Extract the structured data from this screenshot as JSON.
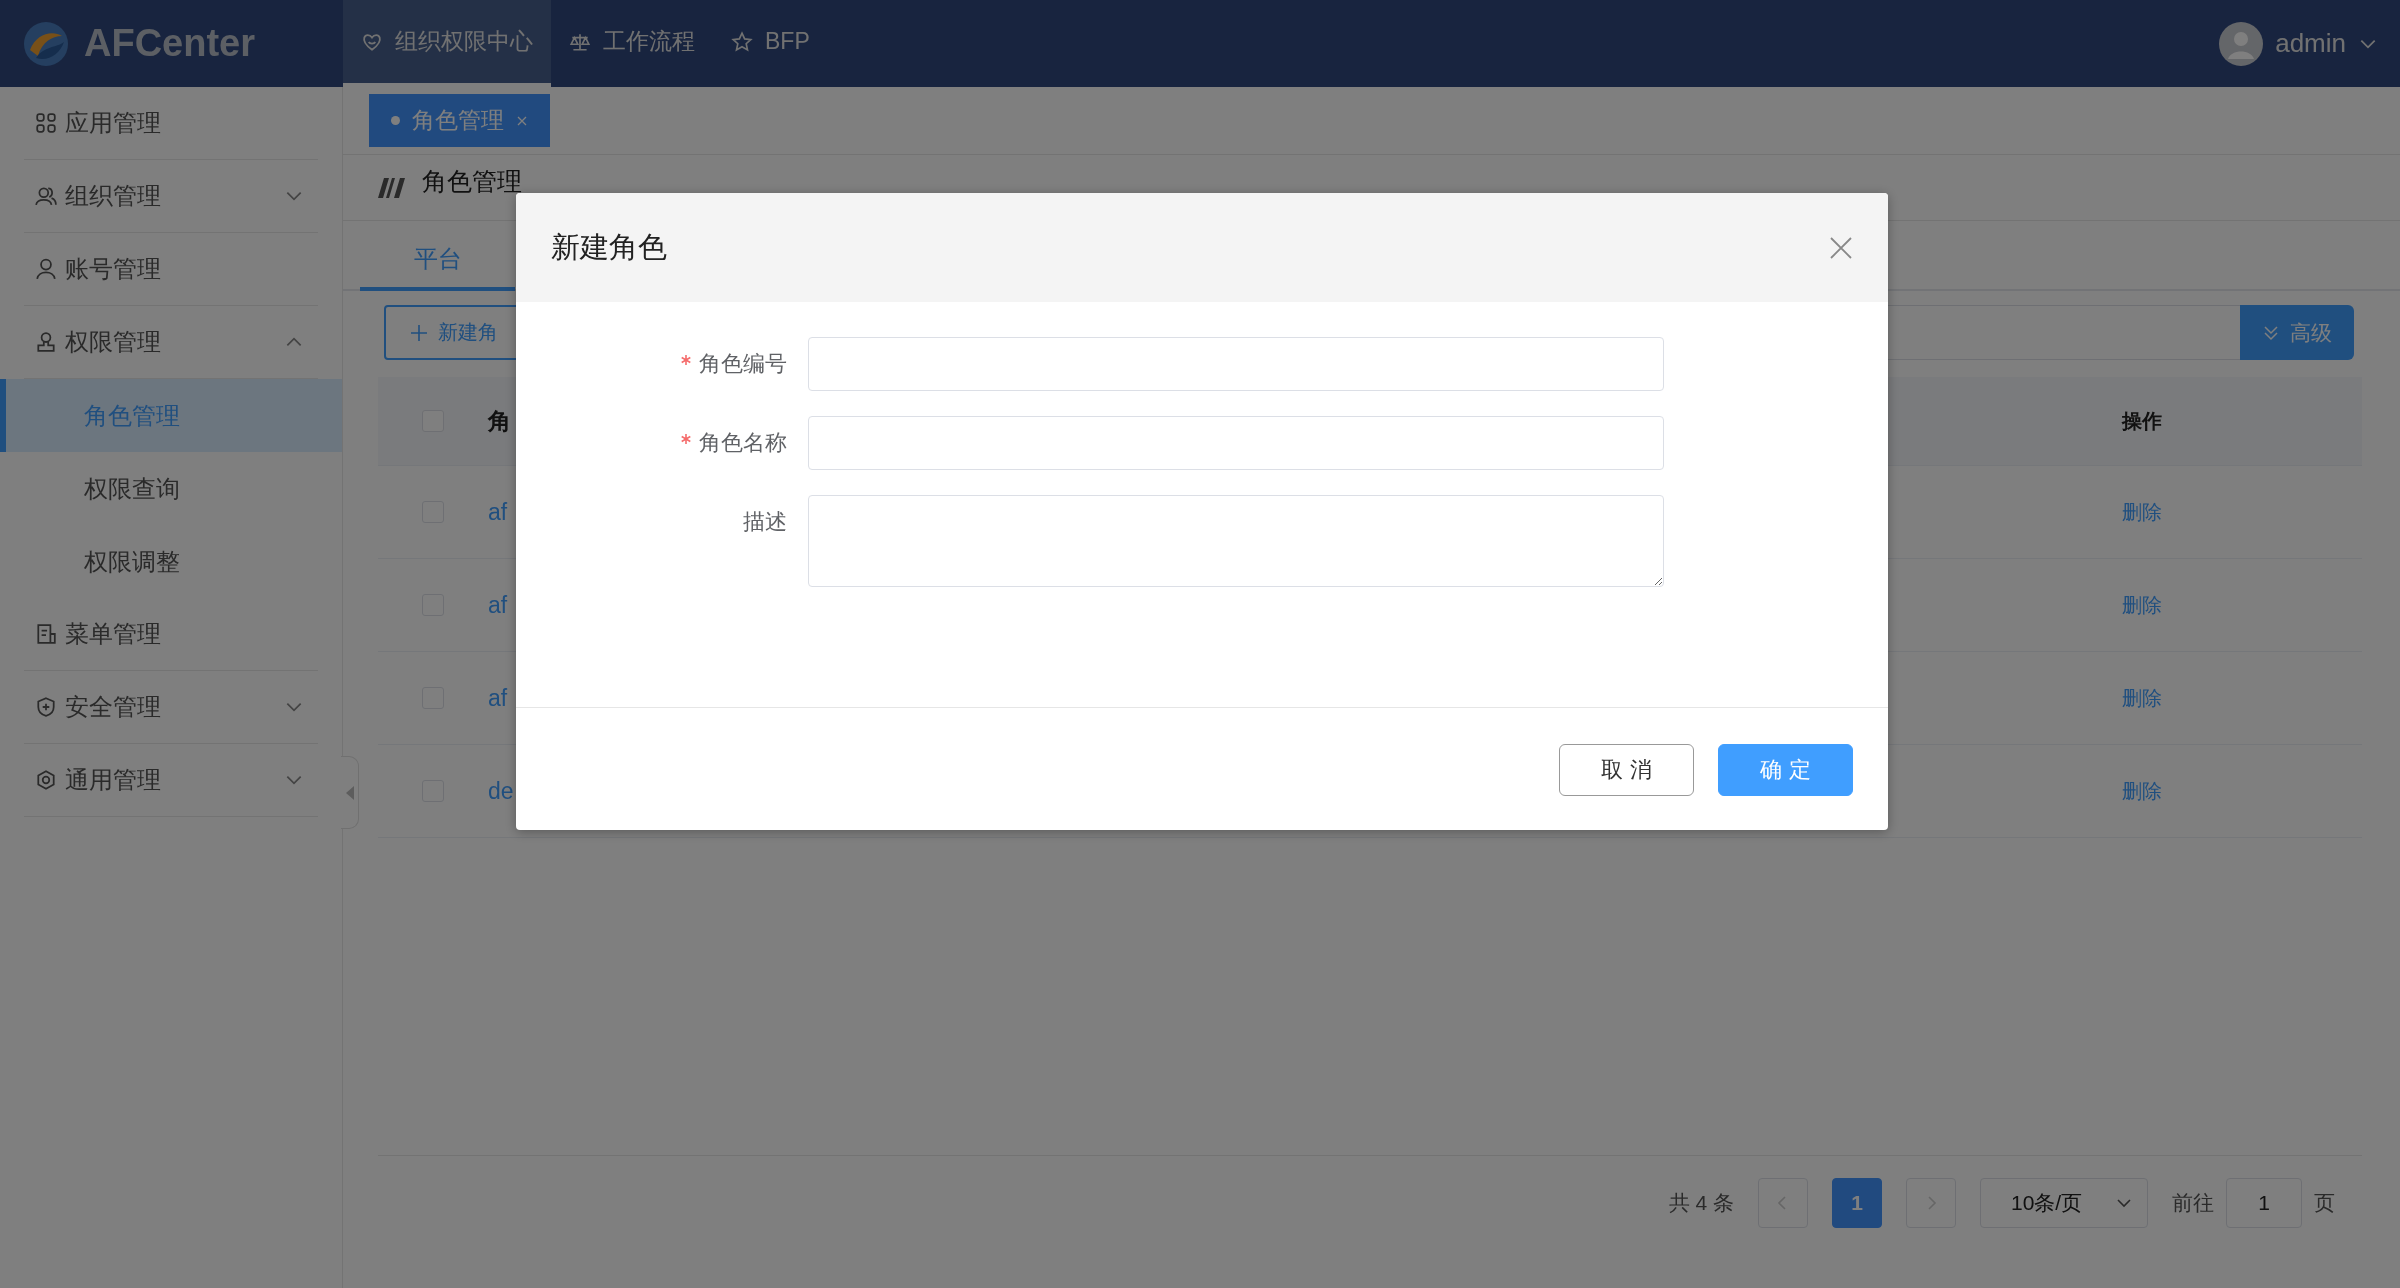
{
  "header": {
    "logo_text": "AFCenter",
    "nav": [
      {
        "label": "组织权限中心",
        "selected": true
      },
      {
        "label": "工作流程",
        "selected": false
      },
      {
        "label": "BFP",
        "selected": false
      }
    ],
    "user": "admin"
  },
  "sidebar": {
    "items": [
      {
        "label": "应用管理",
        "kind": "link"
      },
      {
        "label": "组织管理",
        "kind": "group",
        "expanded": false
      },
      {
        "label": "账号管理",
        "kind": "link"
      },
      {
        "label": "权限管理",
        "kind": "group",
        "expanded": true,
        "children": [
          {
            "label": "角色管理",
            "selected": true
          },
          {
            "label": "权限查询",
            "selected": false
          },
          {
            "label": "权限调整",
            "selected": false
          }
        ]
      },
      {
        "label": "菜单管理",
        "kind": "link"
      },
      {
        "label": "安全管理",
        "kind": "group",
        "expanded": false
      },
      {
        "label": "通用管理",
        "kind": "group",
        "expanded": false
      }
    ]
  },
  "page_tabs": [
    {
      "label": "角色管理",
      "selected": true
    }
  ],
  "page_title": "角色管理",
  "tabs": [
    {
      "label": "平台",
      "selected": true
    }
  ],
  "toolbar": {
    "new_button": "新建角",
    "advanced_button": "高级"
  },
  "table": {
    "select_all_checked": false,
    "columns": [
      "角",
      "操作"
    ],
    "rows": [
      {
        "checked": false,
        "column_1": "af",
        "operation": "删除"
      },
      {
        "checked": false,
        "column_1": "af",
        "operation": "删除"
      },
      {
        "checked": false,
        "column_1": "af",
        "operation": "删除"
      },
      {
        "checked": false,
        "column_1": "de",
        "operation": "删除"
      }
    ]
  },
  "pagination": {
    "total": "共 4 条",
    "pages": [
      {
        "label": "1",
        "selected": true
      }
    ],
    "page_size": "10条/页",
    "goto_label": "前往",
    "goto_value": "1",
    "page_suffix": "页"
  },
  "dialog": {
    "title": "新建角色",
    "fields": [
      {
        "label": "角色编号",
        "required": true,
        "kind": "input"
      },
      {
        "label": "角色名称",
        "required": true,
        "kind": "input"
      },
      {
        "label": "描述",
        "required": false,
        "kind": "textarea"
      }
    ],
    "buttons": [
      {
        "label": "取 消",
        "kind": "default"
      },
      {
        "label": "确 定",
        "kind": "primary"
      }
    ]
  }
}
